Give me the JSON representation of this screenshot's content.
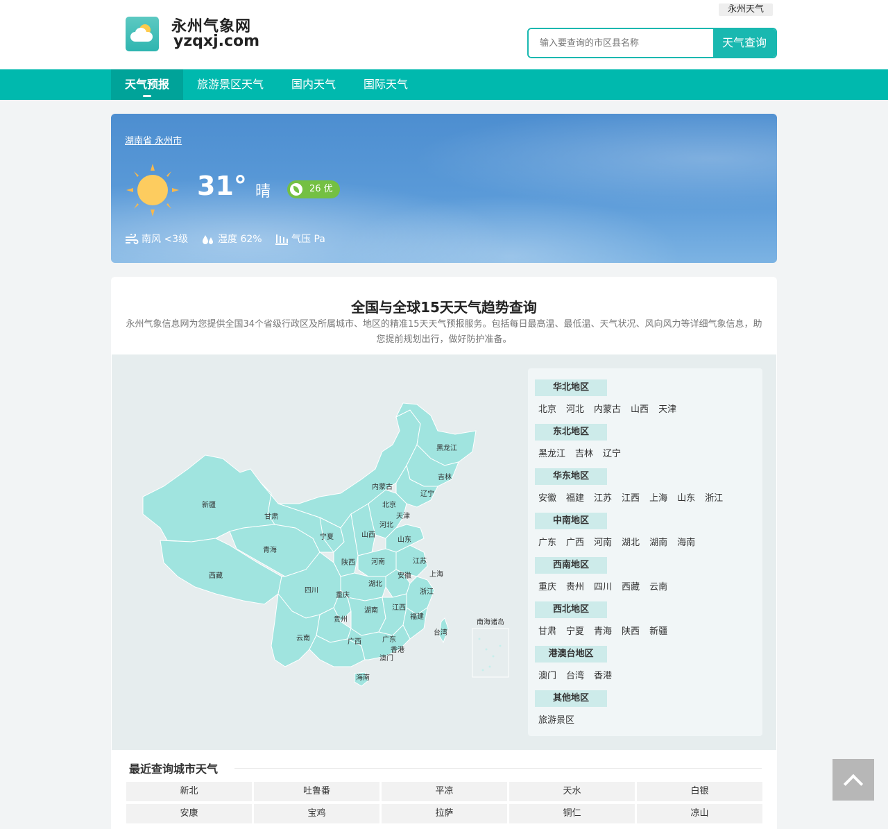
{
  "header": {
    "site_title": "永州气象网",
    "site_domain": "yzqxj.com",
    "city_tag": "永州天气",
    "search_placeholder": "输入要查询的市区县名称",
    "search_button": "天气查询"
  },
  "nav": {
    "items": [
      {
        "label": "天气预报",
        "active": true
      },
      {
        "label": "旅游景区天气"
      },
      {
        "label": "国内天气"
      },
      {
        "label": "国际天气"
      }
    ]
  },
  "weather": {
    "location": "湖南省 永州市",
    "temperature": "31°",
    "condition": "晴",
    "aqi": "26 优",
    "wind": "南风 <3级",
    "humidity": "湿度 62%",
    "pressure": "气压 Pa"
  },
  "main": {
    "title": "全国与全球15天天气趋势查询",
    "description": "永州气象信息网为您提供全国34个省级行政区及所属城市、地区的精准15天天气预报服务。包括每日最高温、最低温、天气状况、风向风力等详细气象信息，助您提前规划出行，做好防护准备。"
  },
  "map_labels": [
    "黑龙江",
    "吉林",
    "辽宁",
    "内蒙古",
    "北京",
    "天津",
    "河北",
    "山西",
    "宁夏",
    "甘肃",
    "新疆",
    "青海",
    "西藏",
    "陕西",
    "河南",
    "山东",
    "江苏",
    "安徽",
    "上海",
    "湖北",
    "四川",
    "重庆",
    "浙江",
    "湖南",
    "江西",
    "福建",
    "贵州",
    "云南",
    "广西",
    "广东",
    "台湾",
    "香港",
    "澳门",
    "海南",
    "南海诸岛"
  ],
  "regions": [
    {
      "title": "华北地区",
      "cities": [
        "北京",
        "河北",
        "内蒙古",
        "山西",
        "天津"
      ]
    },
    {
      "title": "东北地区",
      "cities": [
        "黑龙江",
        "吉林",
        "辽宁"
      ]
    },
    {
      "title": "华东地区",
      "cities": [
        "安徽",
        "福建",
        "江苏",
        "江西",
        "上海",
        "山东",
        "浙江"
      ]
    },
    {
      "title": "中南地区",
      "cities": [
        "广东",
        "广西",
        "河南",
        "湖北",
        "湖南",
        "海南"
      ]
    },
    {
      "title": "西南地区",
      "cities": [
        "重庆",
        "贵州",
        "四川",
        "西藏",
        "云南"
      ]
    },
    {
      "title": "西北地区",
      "cities": [
        "甘肃",
        "宁夏",
        "青海",
        "陕西",
        "新疆"
      ]
    },
    {
      "title": "港澳台地区",
      "cities": [
        "澳门",
        "台湾",
        "香港"
      ]
    },
    {
      "title": "其他地区",
      "cities": [
        "旅游景区"
      ]
    }
  ],
  "recent": {
    "title": "最近查询城市天气",
    "cities": [
      "新北",
      "吐鲁番",
      "平凉",
      "天水",
      "白银",
      "安康",
      "宝鸡",
      "拉萨",
      "铜仁",
      "凉山"
    ]
  },
  "colors": {
    "accent": "#00b9ae",
    "map_fill": "#a0e4df",
    "aqi_good": "#74c043"
  }
}
